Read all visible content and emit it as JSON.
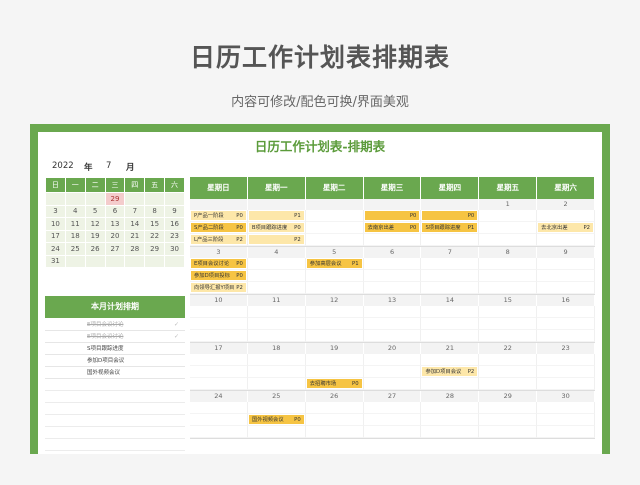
{
  "hero": {
    "title": "日历工作计划表排期表",
    "subtitle": "内容可修改/配色可换/界面美观"
  },
  "sheet_title": "日历工作计划表-排期表",
  "year": "2022",
  "year_label": "年",
  "month": "7",
  "month_label": "月",
  "mini_weekdays": [
    "日",
    "一",
    "二",
    "三",
    "四",
    "五",
    "六"
  ],
  "mini_weeks": [
    [
      "",
      "",
      "",
      "29",
      "",
      "",
      ""
    ],
    [
      "3",
      "4",
      "5",
      "6",
      "7",
      "8",
      "9"
    ],
    [
      "10",
      "11",
      "12",
      "13",
      "14",
      "15",
      "16"
    ],
    [
      "17",
      "18",
      "19",
      "20",
      "21",
      "22",
      "23"
    ],
    [
      "24",
      "25",
      "26",
      "27",
      "28",
      "29",
      "30"
    ],
    [
      "31",
      "",
      "",
      "",
      "",
      "",
      ""
    ]
  ],
  "plan_title": "本月计划排期",
  "plan_items": [
    {
      "text": "E项目会议讨论",
      "done": true,
      "mark": "✓"
    },
    {
      "text": "E项目会议讨论",
      "done": true,
      "mark": "✓"
    },
    {
      "text": "S项目跟踪进度",
      "done": false,
      "mark": ""
    },
    {
      "text": "参加D项目会议",
      "done": false,
      "mark": ""
    },
    {
      "text": "国外视频会议",
      "done": false,
      "mark": ""
    }
  ],
  "cal_weekdays": [
    "星期日",
    "星期一",
    "星期二",
    "星期三",
    "星期四",
    "星期五",
    "星期六"
  ],
  "weeks": [
    {
      "days": [
        "",
        "",
        "",
        "",
        "",
        "1",
        "2"
      ],
      "rows": [
        [
          {
            "t": "P产品一阶段",
            "p": "P0",
            "c": "l"
          },
          {
            "t": "",
            "p": "P1",
            "c": "l"
          },
          null,
          {
            "t": "",
            "p": "P0",
            "c": "y"
          },
          {
            "t": "",
            "p": "P0",
            "c": "y"
          },
          null,
          null
        ],
        [
          {
            "t": "S产品二阶段",
            "p": "P0",
            "c": "y"
          },
          {
            "t": "B项目跟踪进度",
            "p": "P0",
            "c": "l"
          },
          null,
          {
            "t": "去南京出差",
            "p": "P0",
            "c": "y"
          },
          {
            "t": "S项目跟踪进度",
            "p": "P1",
            "c": "y"
          },
          null,
          {
            "t": "去北京出差",
            "p": "P2",
            "c": "l"
          }
        ],
        [
          {
            "t": "L产品三阶段",
            "p": "P2",
            "c": "l"
          },
          {
            "t": "",
            "p": "P2",
            "c": "l"
          },
          null,
          null,
          null,
          null,
          null
        ]
      ]
    },
    {
      "days": [
        "3",
        "4",
        "5",
        "6",
        "7",
        "8",
        "9"
      ],
      "rows": [
        [
          {
            "t": "E项目会议讨论",
            "p": "P0",
            "c": "y"
          },
          null,
          {
            "t": "参加高层会议",
            "p": "P1",
            "c": "y"
          },
          null,
          null,
          null,
          null
        ],
        [
          {
            "t": "参加D项目投标",
            "p": "P0",
            "c": "y"
          },
          null,
          null,
          null,
          null,
          null,
          null
        ],
        [
          {
            "t": "向领导汇报Y项目",
            "p": "P2",
            "c": "l"
          },
          null,
          null,
          null,
          null,
          null,
          null
        ]
      ]
    },
    {
      "days": [
        "10",
        "11",
        "12",
        "13",
        "14",
        "15",
        "16"
      ],
      "rows": [
        [
          null,
          null,
          null,
          null,
          null,
          null,
          null
        ],
        [
          null,
          null,
          null,
          null,
          null,
          null,
          null
        ],
        [
          null,
          null,
          null,
          null,
          null,
          null,
          null
        ]
      ]
    },
    {
      "days": [
        "17",
        "18",
        "19",
        "20",
        "21",
        "22",
        "23"
      ],
      "rows": [
        [
          null,
          null,
          null,
          null,
          null,
          null,
          null
        ],
        [
          null,
          null,
          null,
          null,
          {
            "t": "参加D项目会议",
            "p": "P2",
            "c": "l"
          },
          null,
          null
        ],
        [
          null,
          null,
          {
            "t": "去招聘市场",
            "p": "P0",
            "c": "y"
          },
          null,
          null,
          null,
          null
        ]
      ]
    },
    {
      "days": [
        "24",
        "25",
        "26",
        "27",
        "28",
        "29",
        "30"
      ],
      "rows": [
        [
          null,
          null,
          null,
          null,
          null,
          null,
          null
        ],
        [
          null,
          {
            "t": "国外视频会议",
            "p": "P0",
            "c": "y"
          },
          null,
          null,
          null,
          null,
          null
        ],
        [
          null,
          null,
          null,
          null,
          null,
          null,
          null
        ]
      ]
    }
  ]
}
